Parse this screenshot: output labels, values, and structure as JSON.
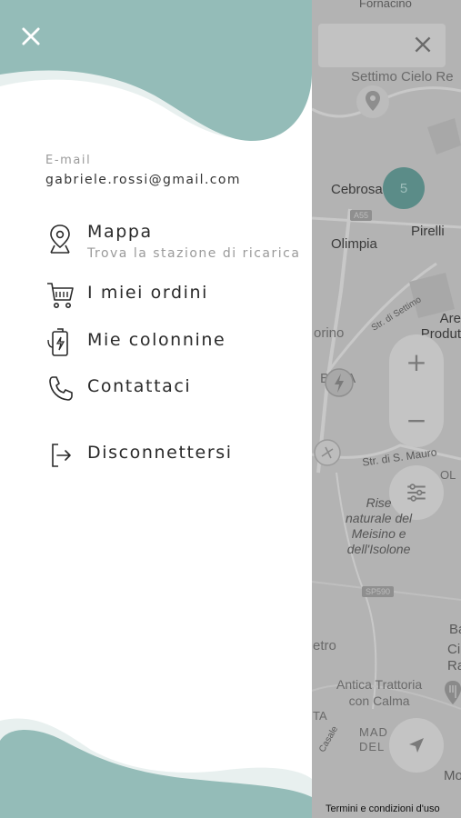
{
  "map": {
    "labels": {
      "fornacino": "Fornacino",
      "settimo_cielo": "Settimo Cielo Re",
      "cebrosa": "Cebrosa",
      "pirelli": "Pirelli",
      "olimpia": "Olimpia",
      "area_produt": "Are\nProdut",
      "orino": "orino",
      "bca": "B  CA",
      "str_settimo": "Str. di Settimo",
      "str_mauro": "Str. di S. Mauro",
      "ol": "OL",
      "riserva": "Rise\nnaturale del\nMeisino e\ndell'Isolone",
      "ba": "Ba",
      "ci": "Ci",
      "ra": "Ra",
      "etro": "etro",
      "antica": "Antica Trattoria\ncon Calma",
      "ta": "TA",
      "mad_del": "MAD\nDEL",
      "casale": "Casale",
      "mo": "Mo",
      "a55": "A55",
      "sp590": "SP590"
    },
    "cluster_count": "5",
    "zoom_in": "+",
    "zoom_out": "−",
    "terms": "Termini e condizioni d'uso"
  },
  "drawer": {
    "email_label": "E-mail",
    "email": "gabriele.rossi@gmail.com",
    "items": [
      {
        "label": "Mappa",
        "sub": "Trova la stazione di ricarica",
        "icon": "map-pin-icon"
      },
      {
        "label": "I miei ordini",
        "icon": "cart-icon"
      },
      {
        "label": "Mie colonnine",
        "icon": "charger-icon"
      },
      {
        "label": "Contattaci",
        "icon": "phone-icon"
      },
      {
        "label": "Disconnettersi",
        "icon": "logout-icon"
      }
    ]
  },
  "colors": {
    "accent_teal": "#94bcb8",
    "accent_teal_light": "#e8f0ef",
    "map_overlay": "#b3b3b3"
  }
}
